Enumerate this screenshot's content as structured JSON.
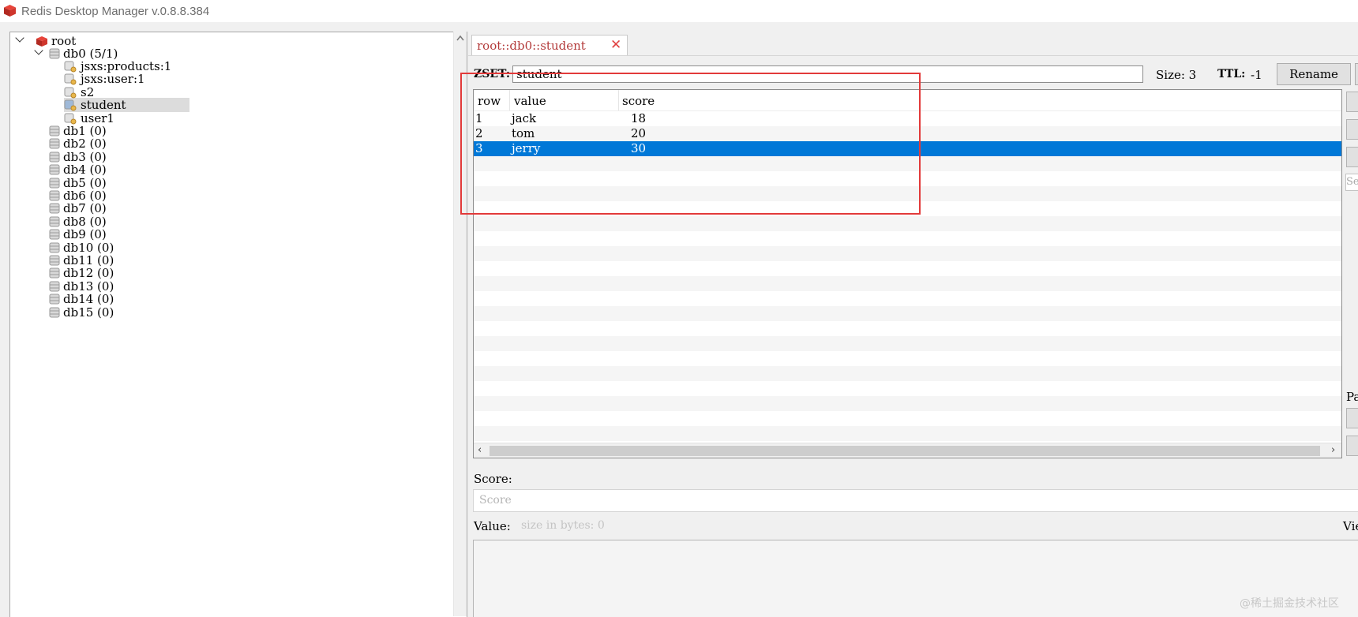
{
  "app": {
    "title": "Redis Desktop Manager v.0.8.8.384"
  },
  "tree": {
    "root_label": "root",
    "db0_label": "db0  (5/1)",
    "keys": [
      {
        "label": "jsxs:products:1"
      },
      {
        "label": "jsxs:user:1"
      },
      {
        "label": "s2"
      },
      {
        "label": "student"
      },
      {
        "label": "user1"
      }
    ],
    "selected_key": "student",
    "dbs": [
      {
        "label": "db1  (0)"
      },
      {
        "label": "db2  (0)"
      },
      {
        "label": "db3  (0)"
      },
      {
        "label": "db4  (0)"
      },
      {
        "label": "db5  (0)"
      },
      {
        "label": "db6  (0)"
      },
      {
        "label": "db7  (0)"
      },
      {
        "label": "db8  (0)"
      },
      {
        "label": "db9  (0)"
      },
      {
        "label": "db10  (0)"
      },
      {
        "label": "db11  (0)"
      },
      {
        "label": "db12  (0)"
      },
      {
        "label": "db13  (0)"
      },
      {
        "label": "db14  (0)"
      },
      {
        "label": "db15  (0)"
      }
    ]
  },
  "tab": {
    "label": "root::db0::student"
  },
  "key_view": {
    "type_label": "ZSET:",
    "key_name": "student",
    "size_text": "Size: 3",
    "ttl_label": "TTL:",
    "ttl_value": "-1",
    "rename_label": "Rename"
  },
  "table": {
    "columns": [
      "row",
      "value",
      "score"
    ],
    "rows": [
      {
        "row": "1",
        "value": "jack",
        "score": "18"
      },
      {
        "row": "2",
        "value": "tom",
        "score": "20"
      },
      {
        "row": "3",
        "value": "jerry",
        "score": "30"
      }
    ],
    "selected_row": "3"
  },
  "side": {
    "search_placeholder": "Se",
    "page_label": "Pa"
  },
  "editor": {
    "score_label": "Score:",
    "score_placeholder": "Score",
    "value_label": "Value:",
    "value_size": "size in bytes: 0",
    "view_label": "Vie"
  },
  "watermark": "@稀土掘金技术社区",
  "colors": {
    "selection": "#0078d7",
    "annotation": "#e23a3a",
    "tab_text": "#b33a3a"
  }
}
